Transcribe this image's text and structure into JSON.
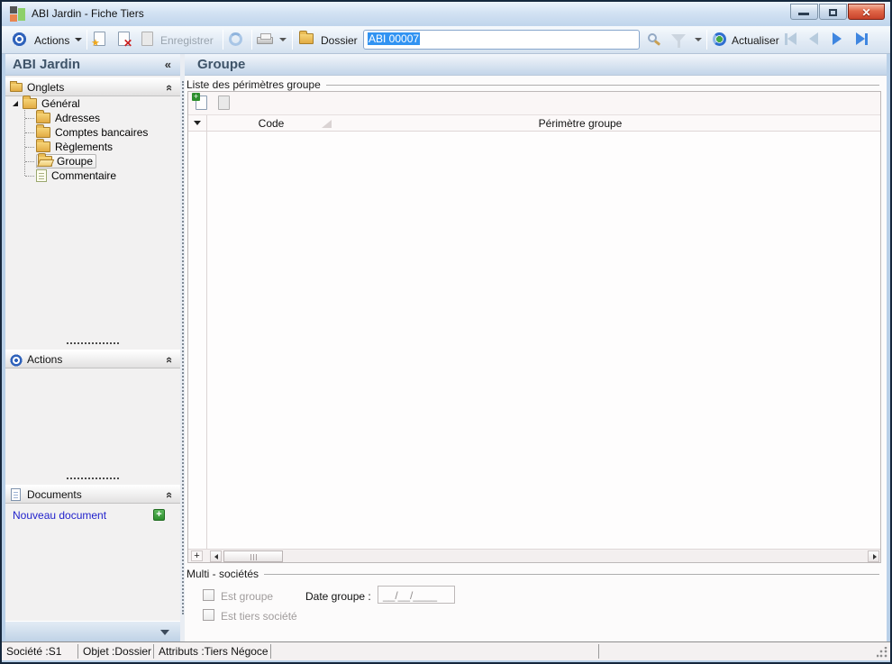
{
  "window": {
    "title": "ABI Jardin -  Fiche Tiers"
  },
  "toolbar": {
    "actions": "Actions",
    "save": "Enregistrer",
    "dossier": "Dossier",
    "record_field_value": "ABI 00007",
    "refresh": "Actualiser"
  },
  "sidebar": {
    "title": "ABI Jardin",
    "onglets_header": "Onglets",
    "actions_header": "Actions",
    "documents_header": "Documents",
    "new_document": "Nouveau document",
    "tree": [
      {
        "label": "Général"
      },
      {
        "label": "Adresses"
      },
      {
        "label": "Comptes bancaires"
      },
      {
        "label": "Règlements"
      },
      {
        "label": "Groupe"
      },
      {
        "label": "Commentaire"
      }
    ]
  },
  "main": {
    "title": "Groupe",
    "groupbox": "Liste des périmètres groupe",
    "table": {
      "col_code": "Code",
      "col_perimetre": "Périmètre groupe"
    },
    "multi": {
      "legend": "Multi - sociétés",
      "est_groupe": "Est groupe",
      "est_tiers": "Est tiers société",
      "date_label": "Date groupe :",
      "date_value": "__/__/____"
    }
  },
  "statusbar": {
    "societe": "Société :S1",
    "objet": "Objet :Dossier",
    "attributs": "Attributs :Tiers Négoce"
  },
  "colors": {
    "accent_blue": "#3f86e0",
    "selection_blue": "#3193f2",
    "link_blue": "#2222cc",
    "plus_green": "#2e8f2e",
    "close_red": "#c8432b"
  }
}
